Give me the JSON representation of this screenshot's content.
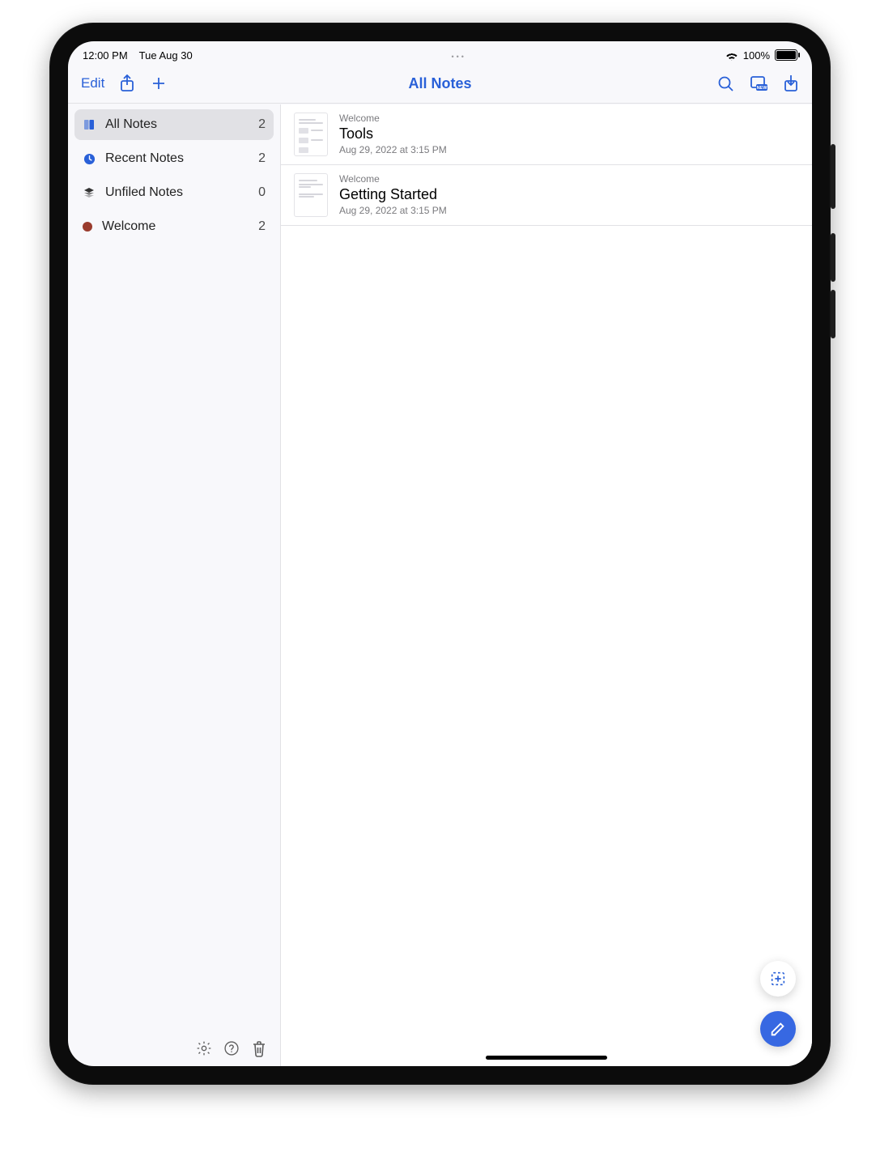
{
  "statusbar": {
    "time": "12:00 PM",
    "date": "Tue Aug 30",
    "battery": "100%"
  },
  "toolbar": {
    "edit": "Edit",
    "title": "All Notes"
  },
  "sidebar": {
    "items": [
      {
        "icon": "book",
        "label": "All Notes",
        "count": "2",
        "selected": true
      },
      {
        "icon": "clock",
        "label": "Recent Notes",
        "count": "2"
      },
      {
        "icon": "stack",
        "label": "Unfiled Notes",
        "count": "0"
      },
      {
        "icon": "dot",
        "dot": "#9a3c2d",
        "label": "Welcome",
        "count": "2"
      }
    ]
  },
  "notes": [
    {
      "category": "Welcome",
      "title": "Tools",
      "date": "Aug 29, 2022 at 3:15 PM"
    },
    {
      "category": "Welcome",
      "title": "Getting Started",
      "date": "Aug 29, 2022 at 3:15 PM"
    }
  ]
}
